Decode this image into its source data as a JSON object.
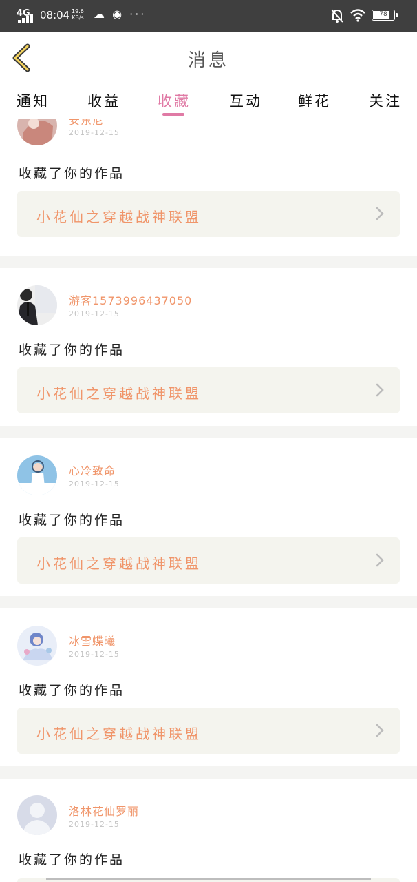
{
  "status_bar": {
    "network": "4G",
    "time": "08:04",
    "speed_value": "19.6",
    "speed_unit": "KB/s",
    "app_icons": "☁ ◉ ···",
    "battery": "78",
    "battery_level": 0.78
  },
  "header": {
    "title": "消息"
  },
  "tabs": [
    {
      "label": "通知"
    },
    {
      "label": "收益"
    },
    {
      "label": "收藏",
      "active": true
    },
    {
      "label": "互动"
    },
    {
      "label": "鲜花"
    },
    {
      "label": "关注"
    }
  ],
  "items": [
    {
      "name": "安东尼",
      "date": "2019-12-15",
      "action": "收藏了你的作品",
      "work": "小花仙之穿越战神联盟"
    },
    {
      "name": "游客1573996437050",
      "date": "2019-12-15",
      "action": "收藏了你的作品",
      "work": "小花仙之穿越战神联盟"
    },
    {
      "name": "心冷致命",
      "date": "2019-12-15",
      "action": "收藏了你的作品",
      "work": "小花仙之穿越战神联盟"
    },
    {
      "name": "冰雪蝶曦",
      "date": "2019-12-15",
      "action": "收藏了你的作品",
      "work": "小花仙之穿越战神联盟"
    },
    {
      "name": "洛林花仙罗丽",
      "date": "2019-12-15",
      "action": "收藏了你的作品"
    }
  ],
  "colors": {
    "accent": "#e07aa5",
    "orange": "#f0956a",
    "card_bg": "#f4f4ee",
    "status_bg": "#3f3f3f"
  }
}
